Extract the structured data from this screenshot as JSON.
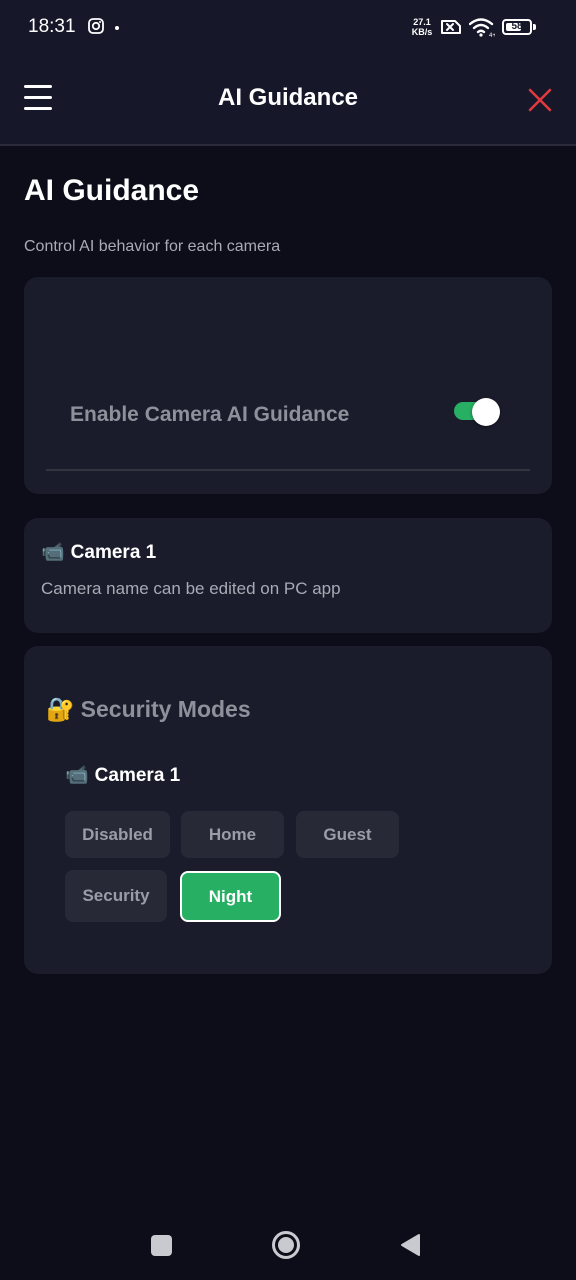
{
  "status_bar": {
    "time": "18:31",
    "network_speed_value": "27.1",
    "network_speed_unit": "KB/s",
    "battery_level": "58",
    "icons": [
      "instagram-icon",
      "no-sim-icon",
      "wifi-icon",
      "battery-icon"
    ]
  },
  "header": {
    "title": "AI Guidance",
    "menu_icon": "hamburger-menu-icon",
    "close_icon": "close-icon",
    "close_color": "#e0393e"
  },
  "page": {
    "title": "AI Guidance",
    "subtitle": "Control AI behavior for each camera"
  },
  "ai_toggle": {
    "label": "Enable Camera AI Guidance",
    "enabled": true,
    "on_color": "#27b063"
  },
  "camera_card": {
    "icon": "📹",
    "name": "Camera 1",
    "note": "Camera name can be edited on PC app"
  },
  "security_modes": {
    "icon": "🔐",
    "heading": "Security Modes",
    "camera_icon": "📹",
    "camera_name": "Camera 1",
    "modes": [
      "Disabled",
      "Home",
      "Guest",
      "Security",
      "Night"
    ],
    "selected": "Night",
    "accent": "#27b063"
  },
  "nav_bar": {
    "icons": [
      "recent-apps-icon",
      "home-icon",
      "back-icon"
    ]
  }
}
